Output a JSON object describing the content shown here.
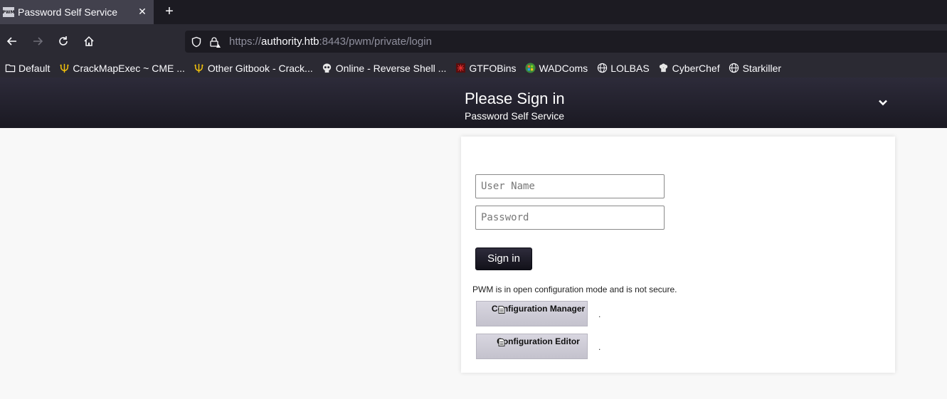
{
  "browser": {
    "tab": {
      "favicon": "PWM",
      "title": "Password Self Service"
    },
    "url": {
      "scheme": "https://",
      "host": "authority.htb",
      "rest": ":8443/pwm/private/login"
    },
    "bookmarks": [
      {
        "label": "Default",
        "icon": "folder-icon"
      },
      {
        "label": "CrackMapExec ~ CME ...",
        "icon": "trident-icon"
      },
      {
        "label": "Other Gitbook - Crack...",
        "icon": "trident-icon"
      },
      {
        "label": "Online - Reverse Shell ...",
        "icon": "skull-icon"
      },
      {
        "label": "GTFOBins",
        "icon": "gtfobins-icon"
      },
      {
        "label": "WADComs",
        "icon": "windows-icon"
      },
      {
        "label": "LOLBAS",
        "icon": "globe-icon"
      },
      {
        "label": "CyberChef",
        "icon": "chef-icon"
      },
      {
        "label": "Starkiller",
        "icon": "globe-icon"
      }
    ]
  },
  "header": {
    "title": "Please Sign in",
    "subtitle": "Password Self Service"
  },
  "login": {
    "username_placeholder": "User Name",
    "password_placeholder": "Password",
    "signin_label": "Sign in",
    "notice": "PWM is in open configuration mode and is not secure.",
    "config_manager_label": "Configuration Manager",
    "config_editor_label": "Configuration Editor",
    "trailing_dot": "."
  },
  "colors": {
    "header_dark": "#1a1922",
    "button_light": "#d0ced8",
    "page_bg": "#f8f8f8"
  }
}
